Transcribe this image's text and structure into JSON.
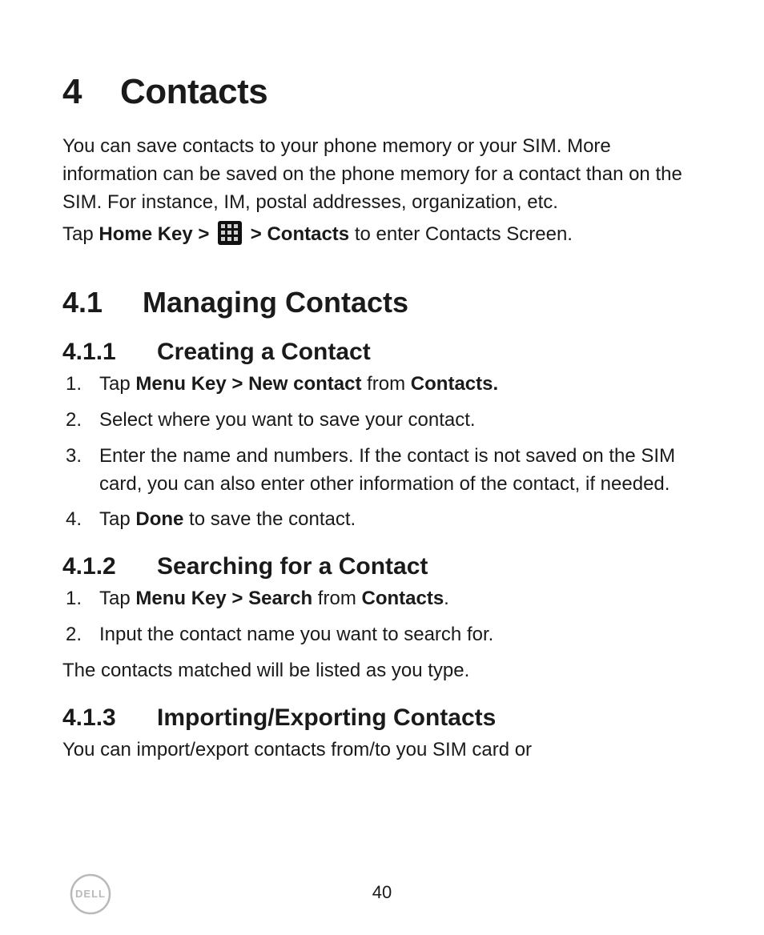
{
  "chapter": {
    "number": "4",
    "title": "Contacts"
  },
  "intro_para": "You can save contacts to your phone memory or your SIM. More information can be saved on the phone memory for a contact than on the SIM. For instance, IM, postal addresses, organization, etc.",
  "tap_line": {
    "prefix": "Tap ",
    "home_key_bold": "Home Key > ",
    "mid": " > ",
    "contacts_bold": "Contacts",
    "suffix": " to enter Contacts Screen."
  },
  "section_41": {
    "number": "4.1",
    "title": "Managing Contacts"
  },
  "sub_411": {
    "number": "4.1.1",
    "title": "Creating a Contact",
    "steps": [
      {
        "runs": [
          {
            "t": "Tap ",
            "b": false
          },
          {
            "t": "Menu Key > New contact",
            "b": true
          },
          {
            "t": " from ",
            "b": false
          },
          {
            "t": "Contacts.",
            "b": true
          }
        ]
      },
      {
        "runs": [
          {
            "t": "Select where you want to save your contact.",
            "b": false
          }
        ]
      },
      {
        "runs": [
          {
            "t": "Enter the name and numbers. If the contact is not saved on the SIM card, you can also enter other information of the contact, if needed.",
            "b": false
          }
        ]
      },
      {
        "runs": [
          {
            "t": "Tap ",
            "b": false
          },
          {
            "t": "Done",
            "b": true
          },
          {
            "t": " to save the contact.",
            "b": false
          }
        ]
      }
    ]
  },
  "sub_412": {
    "number": "4.1.2",
    "title": "Searching for a Contact",
    "steps": [
      {
        "runs": [
          {
            "t": "Tap ",
            "b": false
          },
          {
            "t": "Menu Key > Search",
            "b": true
          },
          {
            "t": " from ",
            "b": false
          },
          {
            "t": "Contacts",
            "b": true
          },
          {
            "t": ".",
            "b": false
          }
        ]
      },
      {
        "runs": [
          {
            "t": "Input the contact name you want to search for.",
            "b": false
          }
        ]
      }
    ],
    "after_para": "The contacts matched will be listed as you type."
  },
  "sub_413": {
    "number": "4.1.3",
    "title": "Importing/Exporting Contacts",
    "para": "You can import/export contacts from/to you SIM card or"
  },
  "page_number": "40",
  "logo_text": "DELL"
}
